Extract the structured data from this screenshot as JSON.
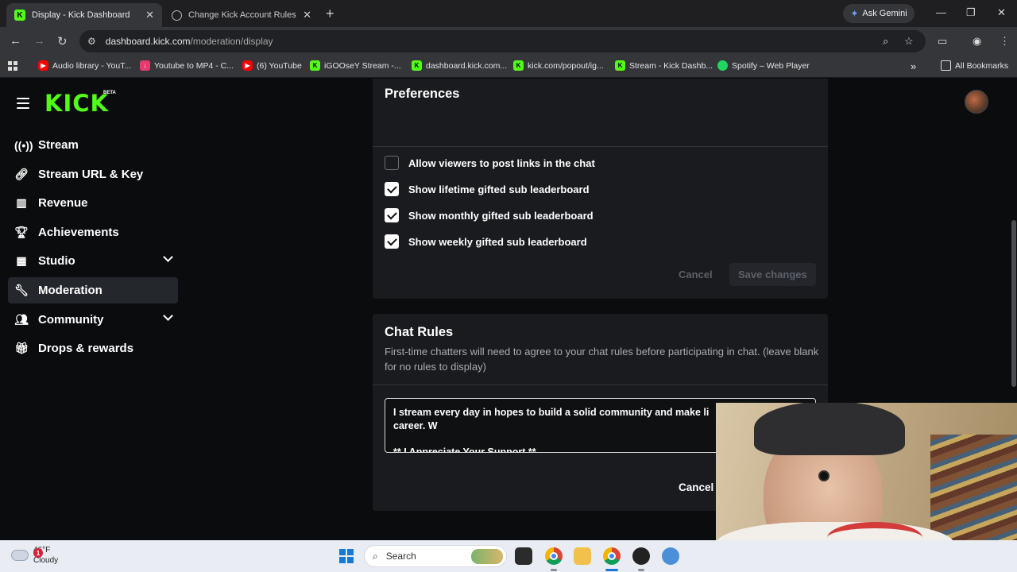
{
  "browser": {
    "tabs": [
      {
        "title": "Display - Kick Dashboard",
        "active": true
      },
      {
        "title": "Change Kick Account Rules",
        "active": false
      }
    ],
    "ask_gemini": "Ask Gemini",
    "url_host": "dashboard.kick.com",
    "url_path": "/moderation/display",
    "bookmarks": [
      {
        "label": "Audio library - YouT...",
        "icon": "youtube"
      },
      {
        "label": "Youtube to MP4 - C...",
        "icon": "download"
      },
      {
        "label": "(6) YouTube",
        "icon": "youtube"
      },
      {
        "label": "iGOOseY Stream -...",
        "icon": "kick"
      },
      {
        "label": "dashboard.kick.com...",
        "icon": "kick"
      },
      {
        "label": "kick.com/popout/ig...",
        "icon": "kick"
      },
      {
        "label": "Stream - Kick Dashb...",
        "icon": "kick"
      },
      {
        "label": "Spotify – Web Player",
        "icon": "spotify"
      }
    ],
    "all_bookmarks": "All Bookmarks"
  },
  "app": {
    "logo": "KICK",
    "logo_badge": "BETA"
  },
  "sidebar": {
    "items": [
      {
        "label": "Stream",
        "icon": "broadcast-icon"
      },
      {
        "label": "Stream URL & Key",
        "icon": "link-icon"
      },
      {
        "label": "Revenue",
        "icon": "bar-chart-icon"
      },
      {
        "label": "Achievements",
        "icon": "trophy-icon"
      },
      {
        "label": "Studio",
        "icon": "grid-icon",
        "expandable": true
      },
      {
        "label": "Moderation",
        "icon": "wrench-icon",
        "active": true
      },
      {
        "label": "Community",
        "icon": "people-icon",
        "expandable": true
      },
      {
        "label": "Drops & rewards",
        "icon": "gift-icon"
      }
    ]
  },
  "preferences": {
    "title": "Preferences",
    "options": [
      {
        "label": "Allow viewers to post links in the chat",
        "checked": false
      },
      {
        "label": "Show lifetime gifted sub leaderboard",
        "checked": true
      },
      {
        "label": "Show monthly gifted sub leaderboard",
        "checked": true
      },
      {
        "label": "Show weekly gifted sub leaderboard",
        "checked": true
      }
    ],
    "cancel": "Cancel",
    "save": "Save changes"
  },
  "chat_rules": {
    "title": "Chat Rules",
    "description": "First-time chatters will need to agree to your chat rules before participating in chat. (leave blank for no rules to display)",
    "text": "I stream every day in hopes to build a solid community and make li\ncareer. W\n\n** I Appreciate Your Support **",
    "cancel": "Cancel"
  },
  "taskbar": {
    "temperature": "46°F",
    "condition": "Cloudy",
    "weather_badge": "1",
    "search_placeholder": "Search"
  }
}
